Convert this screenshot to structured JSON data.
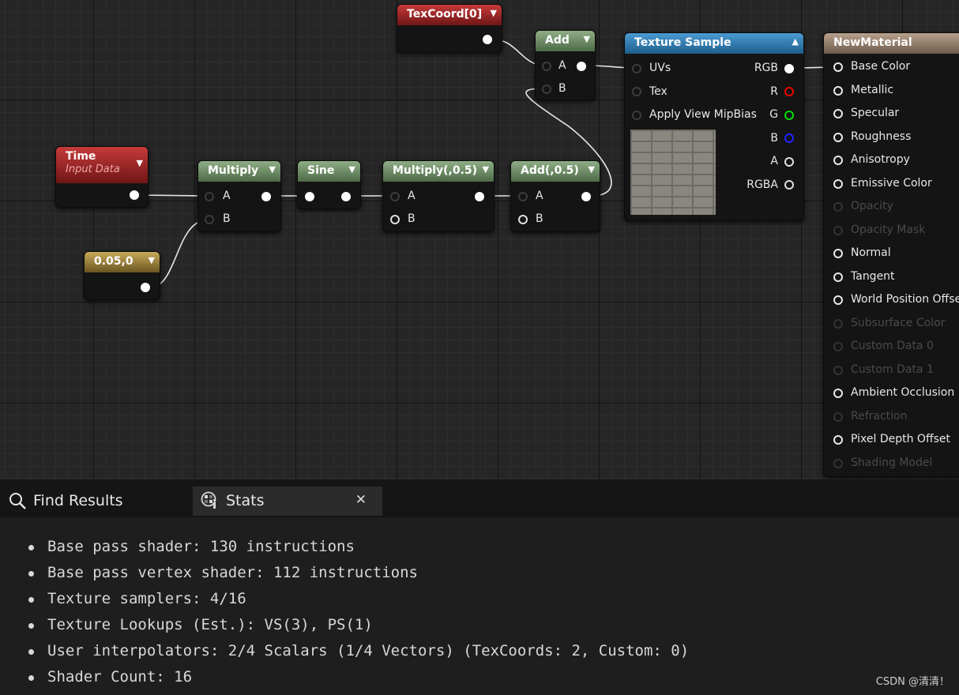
{
  "graph": {
    "nodes": {
      "texcoord": {
        "title": "TexCoord[0]"
      },
      "add": {
        "title": "Add",
        "pin_a": "A",
        "pin_b": "B"
      },
      "texture_sample": {
        "title": "Texture Sample",
        "inputs": [
          "UVs",
          "Tex",
          "Apply View MipBias"
        ],
        "outputs": [
          "RGB",
          "R",
          "G",
          "B",
          "A",
          "RGBA"
        ]
      },
      "time": {
        "title": "Time",
        "subtitle": "Input Data"
      },
      "multiply": {
        "title": "Multiply",
        "pin_a": "A",
        "pin_b": "B"
      },
      "sine": {
        "title": "Sine"
      },
      "multiply05": {
        "title": "Multiply(,0.5)",
        "pin_a": "A",
        "pin_b": "B"
      },
      "add05": {
        "title": "Add(,0.5)",
        "pin_a": "A",
        "pin_b": "B"
      },
      "constant": {
        "title": "0.05,0"
      }
    },
    "material": {
      "title": "NewMaterial",
      "inputs": [
        {
          "label": "Base Color",
          "enabled": true
        },
        {
          "label": "Metallic",
          "enabled": true
        },
        {
          "label": "Specular",
          "enabled": true
        },
        {
          "label": "Roughness",
          "enabled": true
        },
        {
          "label": "Anisotropy",
          "enabled": true
        },
        {
          "label": "Emissive Color",
          "enabled": true
        },
        {
          "label": "Opacity",
          "enabled": false
        },
        {
          "label": "Opacity Mask",
          "enabled": false
        },
        {
          "label": "Normal",
          "enabled": true
        },
        {
          "label": "Tangent",
          "enabled": true
        },
        {
          "label": "World Position Offset",
          "enabled": true
        },
        {
          "label": "Subsurface Color",
          "enabled": false
        },
        {
          "label": "Custom Data 0",
          "enabled": false
        },
        {
          "label": "Custom Data 1",
          "enabled": false
        },
        {
          "label": "Ambient Occlusion",
          "enabled": true
        },
        {
          "label": "Refraction",
          "enabled": false
        },
        {
          "label": "Pixel Depth Offset",
          "enabled": true
        },
        {
          "label": "Shading Model",
          "enabled": false
        }
      ]
    }
  },
  "tabs": {
    "find_results": "Find Results",
    "stats": "Stats"
  },
  "stats": [
    "Base pass shader: 130 instructions",
    "Base pass vertex shader: 112 instructions",
    "Texture samplers: 4/16",
    "Texture Lookups (Est.): VS(3), PS(1)",
    "User interpolators: 2/4 Scalars (1/4 Vectors) (TexCoords: 2, Custom: 0)",
    "Shader Count: 16"
  ],
  "watermark": "CSDN @清清！",
  "colors": {
    "node_body": "#141414",
    "header_green": "#5f7d58",
    "header_red": "#9c2424",
    "header_gold": "#9a8038",
    "header_blue": "#2f7cb3",
    "header_tan": "#8c7866"
  }
}
